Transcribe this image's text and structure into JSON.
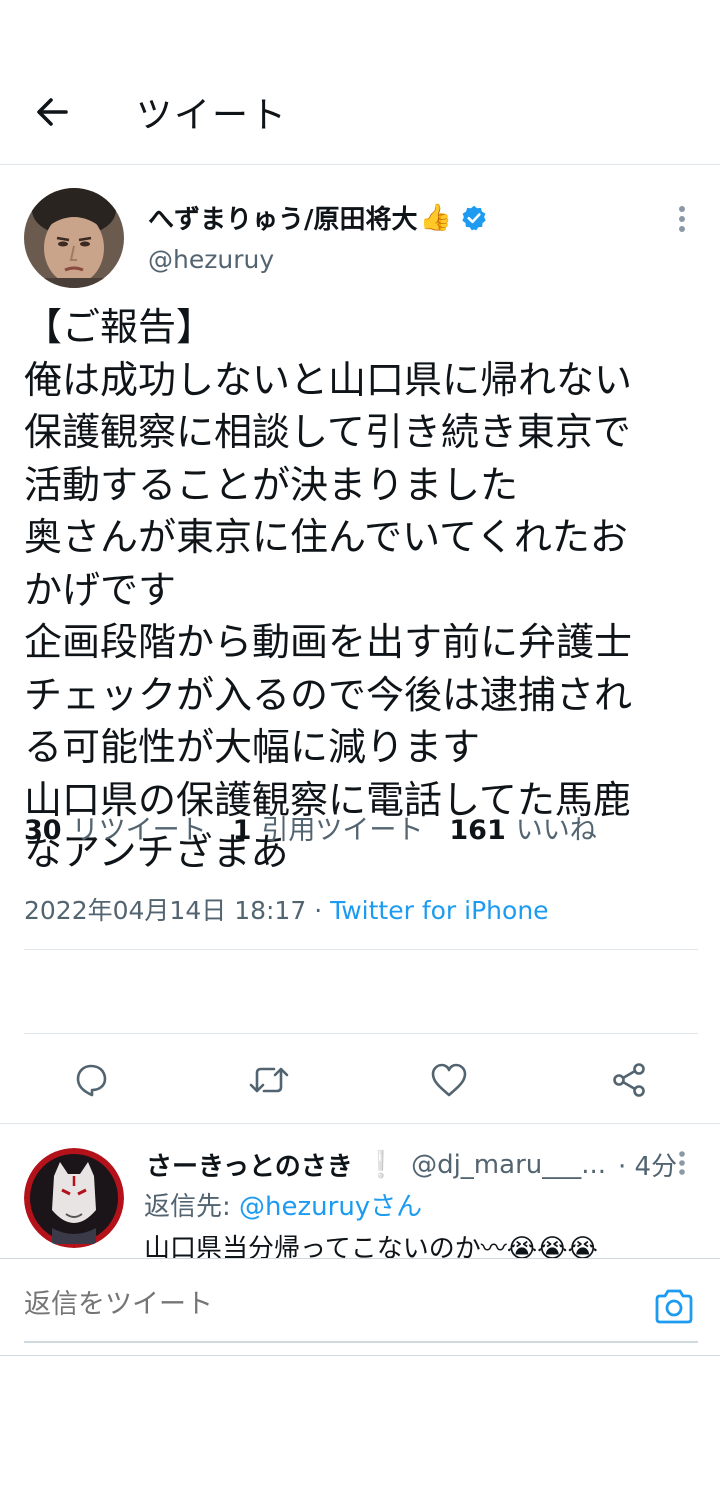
{
  "header": {
    "title": "ツイート"
  },
  "tweet": {
    "author_name": "へずまりゅう/原田将大",
    "author_emoji": "👍",
    "author_handle": "@hezuruy",
    "text": "【ご報告】\n俺は成功しないと山口県に帰れない\n保護観察に相談して引き続き東京で\n活動することが決まりました\n奥さんが東京に住んでいてくれたお\nかげです\n企画段階から動画を出す前に弁護士\nチェックが入るので今後は逮捕され\nる可能性が大幅に減ります\n山口県の保護観察に電話してた馬鹿\nなアンチざまあ",
    "timestamp": "2022年04月14日 18:17",
    "separator": " · ",
    "source": "Twitter for iPhone"
  },
  "stats": {
    "retweets_count": "30",
    "retweets_label": "リツイート",
    "quotes_count": "1",
    "quotes_label": "引用ツイート",
    "likes_count": "161",
    "likes_label": "いいね"
  },
  "reply": {
    "name": "さーきっとのさき",
    "mark": "❕",
    "handle": "@dj_maru___...",
    "time": "· 4分",
    "reply_to_prefix": "返信先: ",
    "reply_to_mention": "@hezuruyさん",
    "text": "山口県当分帰ってこないのか〰😭😭😭"
  },
  "compose": {
    "placeholder": "返信をツイート"
  },
  "colors": {
    "accent": "#1d9bf0",
    "text_primary": "#0f1419",
    "text_secondary": "#536471",
    "divider": "#e1e6ea"
  },
  "icons": {
    "back": "arrow-left-icon",
    "verified": "verified-badge-icon",
    "more": "more-vertical-icon",
    "reply": "reply-icon",
    "retweet": "retweet-icon",
    "like": "heart-icon",
    "share": "share-icon",
    "camera": "camera-icon"
  }
}
